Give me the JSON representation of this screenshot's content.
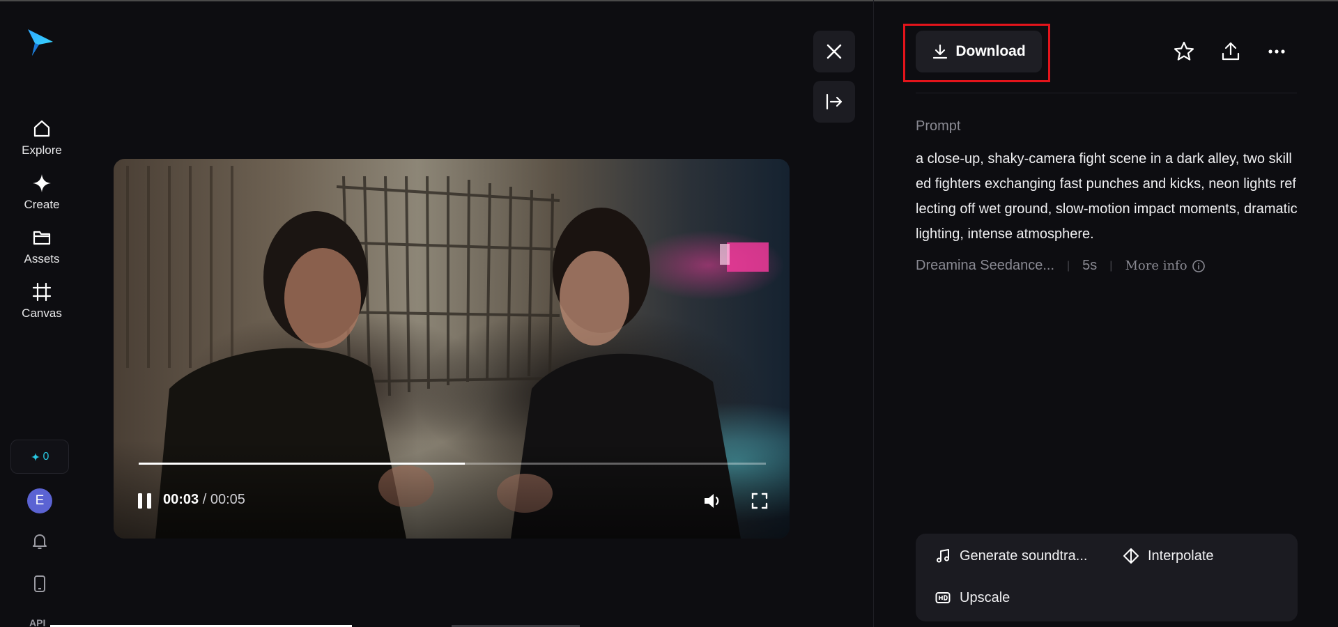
{
  "sidebar": {
    "logo": "app-logo",
    "items": [
      {
        "label": "Explore",
        "icon": "home-icon"
      },
      {
        "label": "Create",
        "icon": "sparkle-icon"
      },
      {
        "label": "Assets",
        "icon": "folder-icon"
      },
      {
        "label": "Canvas",
        "icon": "canvas-icon"
      }
    ],
    "credits": {
      "icon": "sparkle-icon",
      "value": "0"
    },
    "avatar_initial": "E",
    "api_label": "API"
  },
  "player": {
    "current_time": "00:03",
    "total_time": "/ 00:05",
    "progress": 0.52,
    "state": "playing"
  },
  "panel": {
    "download_label": "Download",
    "prompt_heading": "Prompt",
    "prompt_text": "a close-up, shaky-camera fight scene in a dark alley, two skilled fighters exchanging fast punches and kicks, neon lights reflecting off wet ground, slow-motion impact moments, dramatic lighting, intense atmosphere.",
    "model": "Dreamina Seedance...",
    "duration": "5s",
    "more_info": "More info",
    "actions": [
      {
        "label": "Generate soundtra...",
        "icon": "music-note-icon"
      },
      {
        "label": "Interpolate",
        "icon": "interpolate-icon"
      },
      {
        "label": "Upscale",
        "icon": "hd-icon"
      }
    ]
  },
  "colors": {
    "background": "#0d0d11",
    "accent": "#28c6e0",
    "highlight": "#e3141b",
    "avatar": "#5b63d3"
  }
}
